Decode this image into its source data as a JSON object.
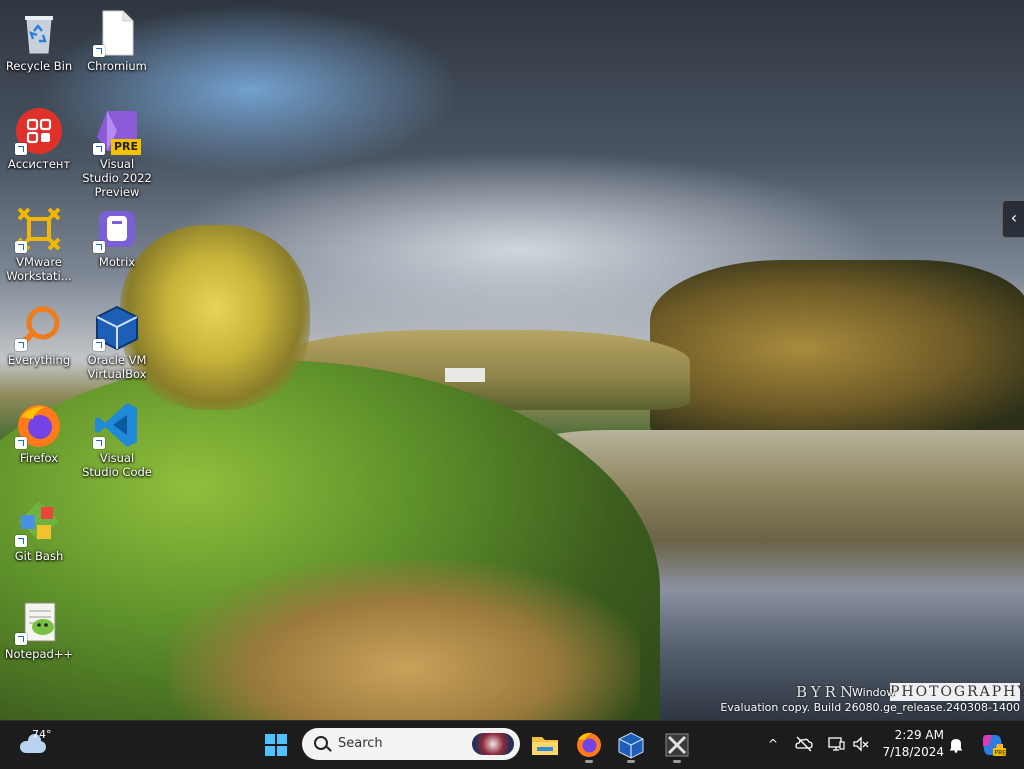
{
  "desktop": {
    "icons": [
      {
        "id": "recycle-bin",
        "label": "Recycle Bin",
        "icon": "recycle-bin-icon"
      },
      {
        "id": "chromium",
        "label": "Chromium",
        "icon": "blank-file-icon"
      },
      {
        "id": "assistant",
        "label": "Ассистент",
        "icon": "assistant-icon"
      },
      {
        "id": "visual-studio-2022-preview",
        "label": "Visual Studio 2022 Preview",
        "icon": "visual-studio-icon",
        "badge": "PRE"
      },
      {
        "id": "vmware-workstation",
        "label": "VMware Workstati...",
        "icon": "vmware-icon"
      },
      {
        "id": "motrix",
        "label": "Motrix",
        "icon": "motrix-icon"
      },
      {
        "id": "everything",
        "label": "Everything",
        "icon": "everything-search-icon"
      },
      {
        "id": "oracle-vm-virtualbox",
        "label": "Oracle VM VirtualBox",
        "icon": "virtualbox-icon"
      },
      {
        "id": "firefox",
        "label": "Firefox",
        "icon": "firefox-icon"
      },
      {
        "id": "visual-studio-code",
        "label": "Visual Studio Code",
        "icon": "vscode-icon"
      },
      {
        "id": "git-bash",
        "label": "Git Bash",
        "icon": "git-bash-icon"
      },
      {
        "id": "notepad-plus-plus",
        "label": "Notepad++",
        "icon": "notepad-plus-plus-icon"
      }
    ],
    "side_tab_glyph": "‹",
    "watermark": {
      "left": "BYRN",
      "right": "PHOTOGRAPHY"
    },
    "windows_text_fragment": "Window",
    "evaluation_text": "Evaluation copy. Build 26080.ge_release.240308-1400"
  },
  "taskbar": {
    "weather": {
      "temperature": "74°",
      "icon": "cloud-icon"
    },
    "search": {
      "placeholder": "Search"
    },
    "pinned_apps": [
      {
        "name": "file-explorer",
        "icon": "folder-icon",
        "running": false
      },
      {
        "name": "firefox",
        "icon": "firefox-icon",
        "running": true
      },
      {
        "name": "virtualbox",
        "icon": "virtualbox-icon",
        "running": true
      },
      {
        "name": "tools",
        "icon": "tools-icon",
        "running": true
      }
    ],
    "tray": {
      "chevron_glyph": "^",
      "icons": [
        "onedrive-offline-icon",
        "display-icon",
        "volume-muted-icon"
      ]
    },
    "clock": {
      "time": "2:29 AM",
      "date": "7/18/2024"
    },
    "colors": {
      "accent": "#4cc2ff",
      "taskbar": "#1c1c1c"
    }
  }
}
